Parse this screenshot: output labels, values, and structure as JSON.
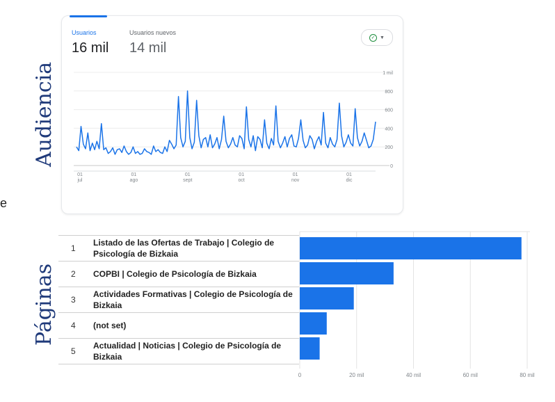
{
  "labels": {
    "audiencia": "Audiencia",
    "paginas": "Páginas",
    "stray": "e"
  },
  "metrics": [
    {
      "label": "Usuarios",
      "value": "16 mil"
    },
    {
      "label": "Usuarios nuevos",
      "value": "14 mil"
    }
  ],
  "colors": {
    "accent": "#1a73e8",
    "status": "#1e8e3e",
    "bar": "#1a73e8"
  },
  "chart_data": [
    {
      "type": "line",
      "title": "",
      "series": [
        {
          "values": [
            200,
            160,
            420,
            230,
            180,
            350,
            160,
            240,
            170,
            260,
            180,
            450,
            170,
            190,
            130,
            150,
            190,
            120,
            170,
            180,
            140,
            210,
            150,
            120,
            140,
            200,
            130,
            150,
            120,
            130,
            180,
            150,
            140,
            120,
            210,
            150,
            170,
            140,
            130,
            200,
            150,
            270,
            230,
            180,
            220,
            740,
            300,
            200,
            260,
            800,
            300,
            180,
            250,
            700,
            320,
            190,
            280,
            300,
            200,
            330,
            190,
            230,
            300,
            180,
            280,
            530,
            260,
            190,
            230,
            300,
            220,
            200,
            320,
            290,
            180,
            630,
            280,
            200,
            320,
            160,
            310,
            280,
            190,
            490,
            240,
            180,
            290,
            220,
            640,
            260,
            190,
            240,
            310,
            200,
            290,
            330,
            210,
            200,
            290,
            490,
            270,
            190,
            220,
            320,
            280,
            180,
            260,
            310,
            220,
            570,
            240,
            190,
            300,
            230,
            200,
            280,
            670,
            320,
            200,
            250,
            330,
            240,
            210,
            610,
            300,
            210,
            260,
            350,
            270,
            190,
            210,
            280,
            470
          ]
        }
      ],
      "x_ticks": [
        "01\njul",
        "01\nago",
        "01\nsept",
        "01\noct",
        "01\nnov",
        "01\ndic"
      ],
      "y_ticks": [
        "0",
        "200",
        "400",
        "600",
        "800",
        "1 mil"
      ],
      "ylim": [
        0,
        1000
      ],
      "grid": true
    },
    {
      "type": "bar",
      "orientation": "horizontal",
      "rows": [
        {
          "rank": "1",
          "name": "Listado de las Ofertas de Trabajo | Colegio de Psicología de Bizkaia",
          "value": 78000
        },
        {
          "rank": "2",
          "name": "COPBI | Colegio de Psicología de Bizkaia",
          "value": 33000
        },
        {
          "rank": "3",
          "name": "Actividades Formativas | Colegio de Psicología de Bizkaia",
          "value": 19000
        },
        {
          "rank": "4",
          "name": "(not set)",
          "value": 9500
        },
        {
          "rank": "5",
          "name": "Actualidad | Noticias | Colegio de Psicología de Bizkaia",
          "value": 7000
        }
      ],
      "x_ticks": [
        "0",
        "20 mil",
        "40 mil",
        "60 mil",
        "80 mil"
      ],
      "xlim": [
        0,
        80000
      ],
      "grid": true
    }
  ]
}
